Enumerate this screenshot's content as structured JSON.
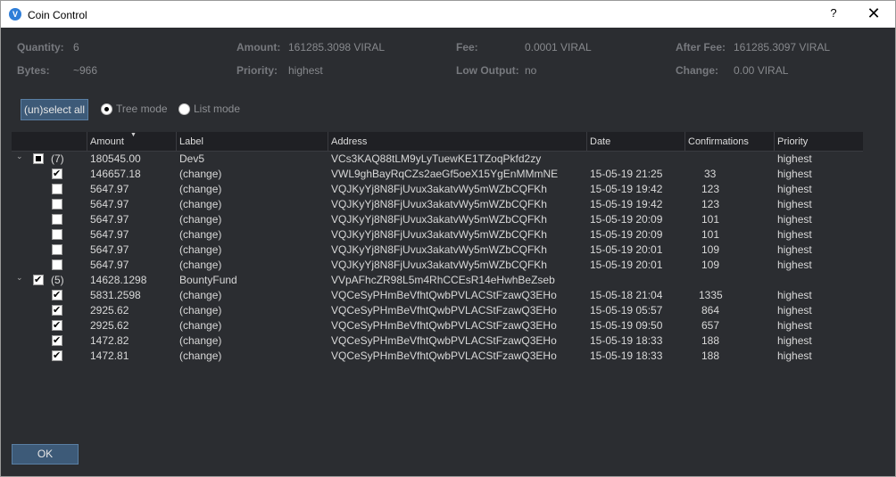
{
  "window": {
    "title": "Coin Control",
    "help_symbol": "?",
    "close_symbol": "✕",
    "app_icon": "V"
  },
  "summary": {
    "quantity": {
      "label": "Quantity:",
      "value": "6"
    },
    "bytes": {
      "label": "Bytes:",
      "value": "~966"
    },
    "amount": {
      "label": "Amount:",
      "value": "161285.3098 VIRAL"
    },
    "priority": {
      "label": "Priority:",
      "value": "highest"
    },
    "fee": {
      "label": "Fee:",
      "value": "0.0001 VIRAL"
    },
    "low_output": {
      "label": "Low Output:",
      "value": "no"
    },
    "after_fee": {
      "label": "After Fee:",
      "value": "161285.3097 VIRAL"
    },
    "change": {
      "label": "Change:",
      "value": "0.00 VIRAL"
    }
  },
  "controls": {
    "unselect_all": "(un)select all",
    "tree_mode": "Tree mode",
    "list_mode": "List mode",
    "ok": "OK"
  },
  "table": {
    "headers": [
      "Amount",
      "Label",
      "Address",
      "Date",
      "Confirmations",
      "Priority"
    ],
    "groups": [
      {
        "count": "(7)",
        "amount": "180545.00",
        "label": "Dev5",
        "address": "VCs3KAQ88tLM9yLyTuewKE1TZoqPkfd2zy",
        "priority": "highest",
        "rows": [
          {
            "checked": true,
            "amount": "146657.18",
            "label": "(change)",
            "address": "VWL9ghBayRqCZs2aeGf5oeX15YgEnMMmNE",
            "date": "15-05-19 21:25",
            "confirmations": "33",
            "priority": "highest"
          },
          {
            "checked": false,
            "amount": "5647.97",
            "label": "(change)",
            "address": "VQJKyYj8N8FjUvux3akatvWy5mWZbCQFKh",
            "date": "15-05-19 19:42",
            "confirmations": "123",
            "priority": "highest"
          },
          {
            "checked": false,
            "amount": "5647.97",
            "label": "(change)",
            "address": "VQJKyYj8N8FjUvux3akatvWy5mWZbCQFKh",
            "date": "15-05-19 19:42",
            "confirmations": "123",
            "priority": "highest"
          },
          {
            "checked": false,
            "amount": "5647.97",
            "label": "(change)",
            "address": "VQJKyYj8N8FjUvux3akatvWy5mWZbCQFKh",
            "date": "15-05-19 20:09",
            "confirmations": "101",
            "priority": "highest"
          },
          {
            "checked": false,
            "amount": "5647.97",
            "label": "(change)",
            "address": "VQJKyYj8N8FjUvux3akatvWy5mWZbCQFKh",
            "date": "15-05-19 20:09",
            "confirmations": "101",
            "priority": "highest"
          },
          {
            "checked": false,
            "amount": "5647.97",
            "label": "(change)",
            "address": "VQJKyYj8N8FjUvux3akatvWy5mWZbCQFKh",
            "date": "15-05-19 20:01",
            "confirmations": "109",
            "priority": "highest"
          },
          {
            "checked": false,
            "amount": "5647.97",
            "label": "(change)",
            "address": "VQJKyYj8N8FjUvux3akatvWy5mWZbCQFKh",
            "date": "15-05-19 20:01",
            "confirmations": "109",
            "priority": "highest"
          }
        ]
      },
      {
        "count": "(5)",
        "amount": "14628.1298",
        "label": "BountyFund",
        "address": "VVpAFhcZR98L5m4RhCCEsR14eHwhBeZseb",
        "priority": "highest",
        "rows": [
          {
            "checked": true,
            "amount": "5831.2598",
            "label": "(change)",
            "address": "VQCeSyPHmBeVfhtQwbPVLACStFzawQ3EHo",
            "date": "15-05-18 21:04",
            "confirmations": "1335",
            "priority": "highest"
          },
          {
            "checked": true,
            "amount": "2925.62",
            "label": "(change)",
            "address": "VQCeSyPHmBeVfhtQwbPVLACStFzawQ3EHo",
            "date": "15-05-19 05:57",
            "confirmations": "864",
            "priority": "highest"
          },
          {
            "checked": true,
            "amount": "2925.62",
            "label": "(change)",
            "address": "VQCeSyPHmBeVfhtQwbPVLACStFzawQ3EHo",
            "date": "15-05-19 09:50",
            "confirmations": "657",
            "priority": "highest"
          },
          {
            "checked": true,
            "amount": "1472.82",
            "label": "(change)",
            "address": "VQCeSyPHmBeVfhtQwbPVLACStFzawQ3EHo",
            "date": "15-05-19 18:33",
            "confirmations": "188",
            "priority": "highest"
          },
          {
            "checked": true,
            "amount": "1472.81",
            "label": "(change)",
            "address": "VQCeSyPHmBeVfhtQwbPVLACStFzawQ3EHo",
            "date": "15-05-19 18:33",
            "confirmations": "188",
            "priority": "highest"
          }
        ]
      }
    ]
  },
  "colors": {
    "background": "#2b2d31",
    "button": "#3d5a78",
    "header": "#1f2024"
  }
}
